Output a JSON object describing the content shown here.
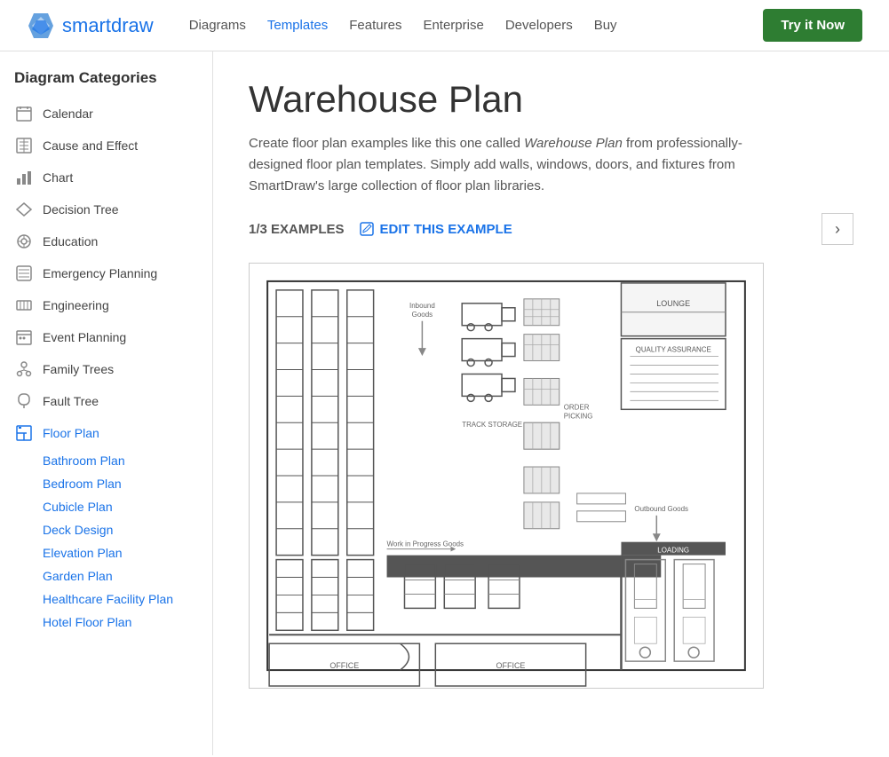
{
  "header": {
    "logo_text_regular": "smart",
    "logo_text_blue": "draw",
    "nav": [
      {
        "label": "Diagrams",
        "active": false
      },
      {
        "label": "Templates",
        "active": true
      },
      {
        "label": "Features",
        "active": false
      },
      {
        "label": "Enterprise",
        "active": false
      },
      {
        "label": "Developers",
        "active": false
      },
      {
        "label": "Buy",
        "active": false
      }
    ],
    "cta": "Try it Now"
  },
  "sidebar": {
    "title": "Diagram Categories",
    "items": [
      {
        "label": "Calendar",
        "icon": "calendar"
      },
      {
        "label": "Cause and Effect",
        "icon": "causeeffect"
      },
      {
        "label": "Chart",
        "icon": "chart"
      },
      {
        "label": "Decision Tree",
        "icon": "decisiontree"
      },
      {
        "label": "Education",
        "icon": "education"
      },
      {
        "label": "Emergency Planning",
        "icon": "emergency"
      },
      {
        "label": "Engineering",
        "icon": "engineering"
      },
      {
        "label": "Event Planning",
        "icon": "event"
      },
      {
        "label": "Family Trees",
        "icon": "familytrees"
      },
      {
        "label": "Fault Tree",
        "icon": "faulttree"
      },
      {
        "label": "Floor Plan",
        "icon": "floorplan",
        "active": true
      }
    ],
    "sub_items": [
      {
        "label": "Bathroom Plan"
      },
      {
        "label": "Bedroom Plan"
      },
      {
        "label": "Cubicle Plan"
      },
      {
        "label": "Deck Design"
      },
      {
        "label": "Elevation Plan"
      },
      {
        "label": "Garden Plan"
      },
      {
        "label": "Healthcare Facility Plan"
      },
      {
        "label": "Hotel Floor Plan"
      }
    ]
  },
  "main": {
    "title": "Warehouse Plan",
    "description_1": "Create floor plan examples like this one called ",
    "description_italic": "Warehouse Plan",
    "description_2": " from professionally-designed floor plan templates. Simply add walls, windows, doors, and fixtures from SmartDraw's large collection of floor plan libraries.",
    "example_count": "1/3 EXAMPLES",
    "edit_label": "EDIT THIS EXAMPLE",
    "next_arrow": "›"
  }
}
